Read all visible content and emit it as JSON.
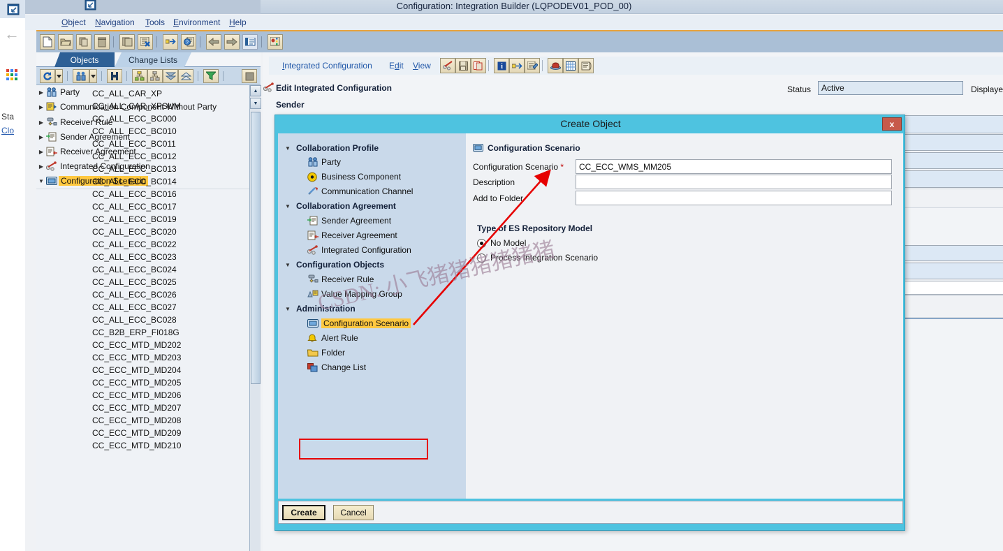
{
  "window": {
    "title": "Configuration: Integration Builder (LQPODEV01_POD_00)"
  },
  "browser_strip": {
    "side_text_1": "Sta",
    "side_link_1": "Clo"
  },
  "menubar": {
    "items": [
      {
        "label": "Object",
        "accel": "O"
      },
      {
        "label": "Navigation",
        "accel": "N"
      },
      {
        "label": "Tools",
        "accel": "T"
      },
      {
        "label": "Environment",
        "accel": "E"
      },
      {
        "label": "Help",
        "accel": "H"
      }
    ]
  },
  "main_toolbar": {
    "buttons": [
      {
        "name": "new-icon"
      },
      {
        "name": "open-folder-icon"
      },
      {
        "name": "copy-icon"
      },
      {
        "name": "delete-trash-icon"
      },
      {
        "name": "save-all-icon"
      },
      {
        "name": "activate-icon"
      },
      {
        "name": "navigate-icon"
      },
      {
        "name": "where-used-icon"
      },
      {
        "name": "back-arrow-icon"
      },
      {
        "name": "forward-arrow-icon"
      },
      {
        "name": "properties-icon"
      },
      {
        "name": "cache-refresh-icon"
      }
    ]
  },
  "nav_panel": {
    "tabs": [
      {
        "label": "Objects",
        "active": true
      },
      {
        "label": "Change Lists",
        "active": false
      }
    ],
    "toolbar_buttons": [
      {
        "name": "refresh-icon"
      },
      {
        "name": "refresh-dropdown-icon"
      },
      {
        "name": "find-objects-icon"
      },
      {
        "name": "find-dropdown-icon"
      },
      {
        "name": "search-binoculars-icon"
      },
      {
        "name": "expand-tree-icon"
      },
      {
        "name": "collapse-tree-icon"
      },
      {
        "name": "collapse-all-icon"
      },
      {
        "name": "expand-all-icon"
      },
      {
        "name": "filter-icon"
      },
      {
        "name": "stop-icon"
      }
    ],
    "tree": [
      {
        "label": "Party",
        "icon": "party-icon",
        "expanded": false
      },
      {
        "label": "Communication Component Without Party",
        "icon": "communication-component-icon",
        "expanded": false
      },
      {
        "label": "Receiver Rule",
        "icon": "receiver-rule-icon",
        "expanded": false
      },
      {
        "label": "Sender Agreement",
        "icon": "sender-agreement-icon",
        "expanded": false
      },
      {
        "label": "Receiver Agreement",
        "icon": "receiver-agreement-icon",
        "expanded": false
      },
      {
        "label": "Integrated Configuration",
        "icon": "integrated-configuration-icon",
        "expanded": false
      },
      {
        "label": "Configuration Scenario",
        "icon": "configuration-scenario-icon",
        "expanded": true,
        "selected": true
      }
    ],
    "scenarios": [
      "CC_ALL_CAR_XP",
      "CC_ALL_CAR_XPSUM",
      "CC_ALL_ECC_BC000",
      "CC_ALL_ECC_BC010",
      "CC_ALL_ECC_BC011",
      "CC_ALL_ECC_BC012",
      "CC_ALL_ECC_BC013",
      "CC_ALL_ECC_BC014",
      "CC_ALL_ECC_BC016",
      "CC_ALL_ECC_BC017",
      "CC_ALL_ECC_BC019",
      "CC_ALL_ECC_BC020",
      "CC_ALL_ECC_BC022",
      "CC_ALL_ECC_BC023",
      "CC_ALL_ECC_BC024",
      "CC_ALL_ECC_BC025",
      "CC_ALL_ECC_BC026",
      "CC_ALL_ECC_BC027",
      "CC_ALL_ECC_BC028",
      "CC_B2B_ERP_FI018G",
      "CC_ECC_MTD_MD202",
      "CC_ECC_MTD_MD203",
      "CC_ECC_MTD_MD204",
      "CC_ECC_MTD_MD205",
      "CC_ECC_MTD_MD206",
      "CC_ECC_MTD_MD207",
      "CC_ECC_MTD_MD208",
      "CC_ECC_MTD_MD209",
      "CC_ECC_MTD_MD210"
    ]
  },
  "content": {
    "menu": [
      {
        "label": "Integrated Configuration",
        "accel": "I"
      },
      {
        "label": "Edit",
        "accel": "d"
      },
      {
        "label": "View",
        "accel": "V"
      }
    ],
    "toolbar_buttons": [
      {
        "name": "edit-pencil-icon"
      },
      {
        "name": "save-icon"
      },
      {
        "name": "copy-object-icon"
      },
      {
        "name": "information-icon"
      },
      {
        "name": "navigate-object-icon"
      },
      {
        "name": "display-change-icon"
      },
      {
        "name": "check-icon"
      },
      {
        "name": "list-icon"
      },
      {
        "name": "log-icon"
      }
    ],
    "edit_title": "Edit Integrated Configuration",
    "sender_label": "Sender",
    "status_label": "Status",
    "status_value": "Active",
    "language_label": "Displayed Lang"
  },
  "dialog": {
    "title": "Create Object",
    "close_label": "x",
    "tree": [
      {
        "type": "group",
        "label": "Collaboration Profile"
      },
      {
        "type": "item",
        "label": "Party",
        "icon": "party-icon"
      },
      {
        "type": "item",
        "label": "Business Component",
        "icon": "business-component-icon"
      },
      {
        "type": "item",
        "label": "Communication Channel",
        "icon": "communication-channel-icon"
      },
      {
        "type": "group",
        "label": "Collaboration Agreement"
      },
      {
        "type": "item",
        "label": "Sender Agreement",
        "icon": "sender-agreement-icon"
      },
      {
        "type": "item",
        "label": "Receiver Agreement",
        "icon": "receiver-agreement-icon"
      },
      {
        "type": "item",
        "label": "Integrated Configuration",
        "icon": "integrated-configuration-icon"
      },
      {
        "type": "group",
        "label": "Configuration Objects"
      },
      {
        "type": "item",
        "label": "Receiver Rule",
        "icon": "receiver-rule-icon"
      },
      {
        "type": "item",
        "label": "Value Mapping Group",
        "icon": "value-mapping-group-icon"
      },
      {
        "type": "group",
        "label": "Administration"
      },
      {
        "type": "item",
        "label": "Configuration Scenario",
        "icon": "configuration-scenario-icon",
        "selected": true
      },
      {
        "type": "item",
        "label": "Alert Rule",
        "icon": "alert-rule-icon"
      },
      {
        "type": "item",
        "label": "Folder",
        "icon": "folder-icon"
      },
      {
        "type": "item",
        "label": "Change List",
        "icon": "change-list-icon"
      }
    ],
    "form": {
      "heading": "Configuration Scenario",
      "fields": [
        {
          "label": "Configuration Scenario",
          "required": true,
          "value": "CC_ECC_WMS_MM205"
        },
        {
          "label": "Description",
          "required": false,
          "value": ""
        },
        {
          "label": "Add to Folder",
          "required": false,
          "value": ""
        }
      ],
      "radio_group_title": "Type of ES Repository Model",
      "radio_options": [
        {
          "label": "No Model",
          "selected": true
        },
        {
          "label": "Process Integration Scenario",
          "selected": false
        }
      ]
    },
    "buttons": {
      "create": "Create",
      "cancel": "Cancel"
    }
  },
  "overlay": {
    "watermark_text": "CSDN: 小飞猪猪猪猪猪猪",
    "annotation_arrow_color": "#e60000",
    "highlight_box_color": "#e60000"
  },
  "colors": {
    "title_bar": "#c2d0e0",
    "accent_orange": "#e8a33d",
    "dialog_frame": "#4ec3e0",
    "selection_yellow": "#ffc840",
    "close_button_red": "#c75a4a",
    "tab_active_blue": "#2e6096"
  }
}
